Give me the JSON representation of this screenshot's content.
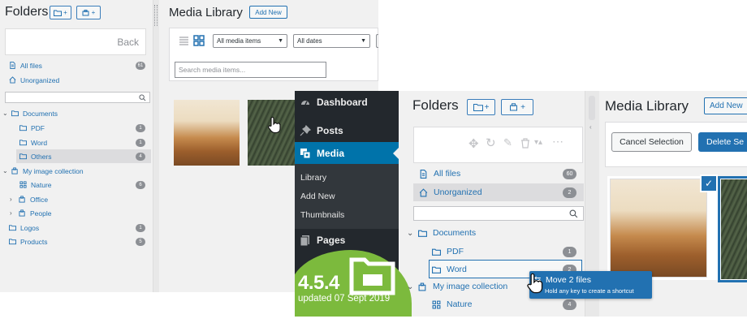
{
  "back": {
    "folders_title": "Folders",
    "back_label": "Back",
    "tree": [
      {
        "label": "All files",
        "count": "61",
        "icon": "file-icon"
      },
      {
        "label": "Unorganized",
        "count": "",
        "icon": "home-icon"
      },
      {
        "label": "Documents",
        "count": "",
        "icon": "folder-icon"
      },
      {
        "label": "PDF",
        "count": "1",
        "icon": "folder-icon"
      },
      {
        "label": "Word",
        "count": "1",
        "icon": "folder-icon"
      },
      {
        "label": "Others",
        "count": "4",
        "icon": "folder-icon"
      },
      {
        "label": "My image collection",
        "count": "",
        "icon": "collection-icon"
      },
      {
        "label": "Nature",
        "count": "6",
        "icon": "grid-icon"
      },
      {
        "label": "Office",
        "count": "",
        "icon": "collection-icon"
      },
      {
        "label": "People",
        "count": "",
        "icon": "collection-icon"
      },
      {
        "label": "Logos",
        "count": "1",
        "icon": "folder-icon"
      },
      {
        "label": "Products",
        "count": "5",
        "icon": "folder-icon"
      }
    ],
    "media_title": "Media Library",
    "add_new": "Add New",
    "filter_type": "All media items",
    "filter_date": "All dates",
    "search_placeholder": "Search media items..."
  },
  "front": {
    "menu": {
      "dashboard": "Dashboard",
      "posts": "Posts",
      "media": "Media",
      "library": "Library",
      "add_new": "Add New",
      "thumbnails": "Thumbnails",
      "pages": "Pages"
    },
    "version": "4.5.4",
    "updated": "updated 07 Sept 2019",
    "folders_title": "Folders",
    "tree": [
      {
        "label": "All files",
        "count": "60"
      },
      {
        "label": "Unorganized",
        "count": "2"
      },
      {
        "label": "Documents",
        "count": ""
      },
      {
        "label": "PDF",
        "count": "1"
      },
      {
        "label": "Word",
        "count": "2"
      },
      {
        "label": "My image collection",
        "count": ""
      },
      {
        "label": "Nature",
        "count": "4"
      }
    ],
    "media_title": "Media Library",
    "add_new": "Add New",
    "cancel_selection": "Cancel Selection",
    "delete_selected": "Delete Se"
  },
  "tooltip": {
    "title": "Move 2 files",
    "hint": "Hold any key to create a shortcut"
  },
  "colors": {
    "accent": "#2271b1",
    "wp_dark": "#23282d",
    "green": "#7cba3d"
  }
}
